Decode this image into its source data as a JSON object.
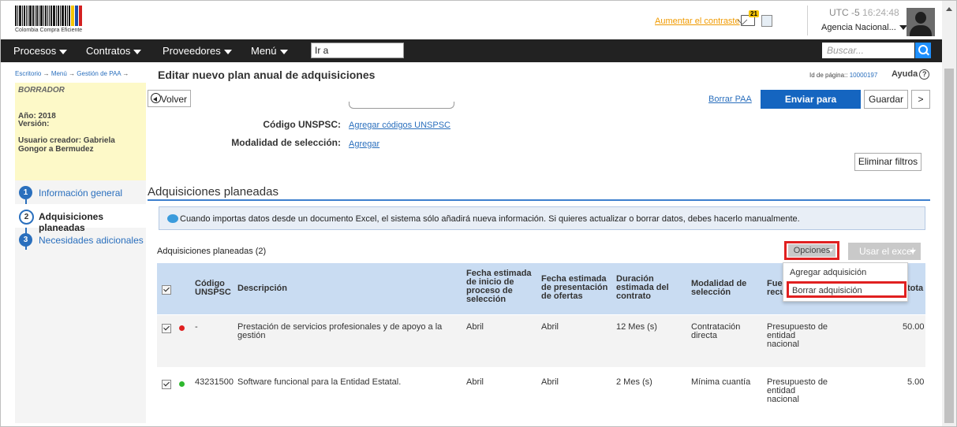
{
  "header": {
    "logo_caption": "Colombia Compra Eficiente",
    "contrast_link": "Aumentar el contraste",
    "notifications_count": "21",
    "utc_label": "UTC -5",
    "time": "16:24:48",
    "agency": "Agencia Nacional..."
  },
  "nav": {
    "items": [
      "Procesos",
      "Contratos",
      "Proveedores",
      "Menú"
    ],
    "goto_value": "Ir a",
    "search_placeholder": "Buscar..."
  },
  "breadcrumb": {
    "items": [
      "Escritorio",
      "Menú",
      "Gestión de PAA"
    ],
    "separator": "→",
    "current": "Editar nuevo plan anual de adquisiciones"
  },
  "page_id": {
    "label": "Id de página::",
    "value": "10000197"
  },
  "help_label": "Ayuda",
  "draft": {
    "status": "BORRADOR",
    "year": "Año: 2018",
    "version": "Versión:",
    "creator": "Usuario creador: Gabriela Gongor a Bermudez"
  },
  "steps": [
    {
      "num": "1",
      "label": "Información general"
    },
    {
      "num": "2",
      "label": "Adquisiciones planeadas"
    },
    {
      "num": "3",
      "label": "Necesidades adicionales"
    }
  ],
  "toolbar": {
    "back": "Volver",
    "delete_paa": "Borrar PAA",
    "send": "Enviar para aprobación",
    "save": "Guardar",
    "more": ">"
  },
  "filters": {
    "unspsc_label": "Código UNSPSC:",
    "unspsc_link": "Agregar códigos UNSPSC",
    "modality_label": "Modalidad de selección:",
    "modality_link": "Agregar",
    "clear": "Eliminar filtros"
  },
  "section": {
    "title": "Adquisiciones planeadas",
    "info": "Cuando importas datos desde un documento Excel, el sistema sólo añadirá nueva información. Si quieres actualizar o borrar datos, debes hacerlo manualmente.",
    "count": "Adquisiciones planeadas (2)",
    "options": "Opciones",
    "excel": "Usar el excel"
  },
  "options_menu": [
    "Agregar adquisición",
    "Borrar adquisición"
  ],
  "table": {
    "headers": {
      "code": "Código UNSPSC",
      "desc": "Descripción",
      "start": "Fecha estimada de inicio de proceso de selección",
      "offers": "Fecha estimada de presentación de ofertas",
      "duration": "Duración estimada del contrato",
      "modality": "Modalidad de selección",
      "source": "Fue recu",
      "total": "tota"
    },
    "rows": [
      {
        "status_color": "#e02020",
        "code": "-",
        "desc": "Prestación de servicios profesionales y de apoyo a la gestión",
        "start": "Abril",
        "offers": "Abril",
        "duration": "12 Mes (s)",
        "modality": "Contratación directa",
        "source": "Presupuesto de entidad nacional",
        "total": "50.00"
      },
      {
        "status_color": "#2eb82e",
        "code": "43231500",
        "desc": "Software funcional para la Entidad Estatal.",
        "start": "Abril",
        "offers": "Abril",
        "duration": "2 Mes (s)",
        "modality": "Mínima cuantía",
        "source": "Presupuesto de entidad nacional",
        "total": "5.00"
      }
    ]
  },
  "colors": {
    "accent": "#1565c0",
    "nav_bg": "#222222",
    "draft_bg": "#fdf9c8",
    "highlight": "#e02020"
  }
}
